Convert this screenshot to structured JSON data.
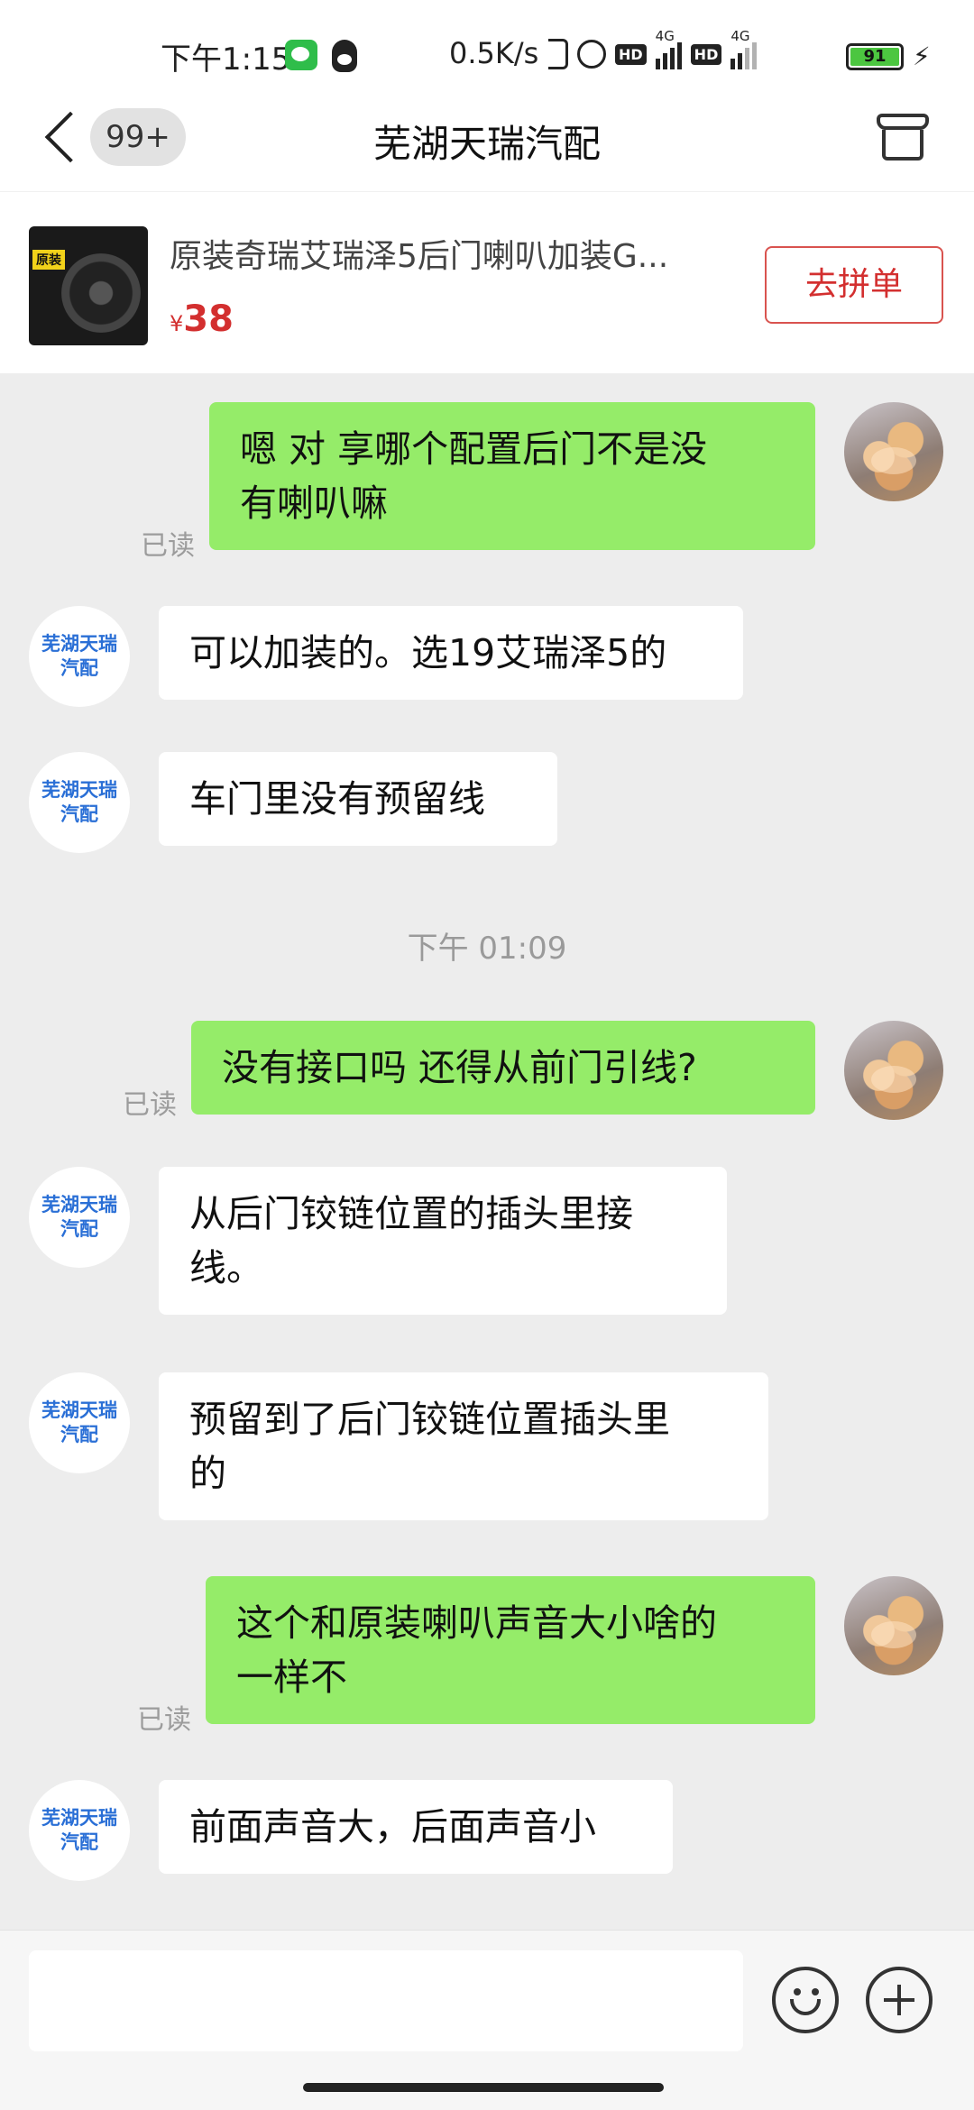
{
  "status_bar": {
    "time": "下午1:15",
    "net_speed": "0.5K/s",
    "hd1": "HD",
    "net1": "4G",
    "hd2": "HD",
    "net2": "4G",
    "battery_level": "91",
    "icons": [
      "wechat-icon",
      "qq-icon",
      "bluetooth-icon",
      "alarm-icon",
      "hd-icon",
      "signal-icon",
      "battery-icon",
      "charging-icon"
    ]
  },
  "header": {
    "back_icon": "back-arrow-icon",
    "unread_badge": "99+",
    "title": "芜湖天瑞汽配",
    "store_icon": "store-icon"
  },
  "product": {
    "image_tag": "原装",
    "title": "原装奇瑞艾瑞泽5后门喇叭加装G...",
    "currency": "¥",
    "price": "38",
    "action_label": "去拼单"
  },
  "shop_avatar": {
    "line1": "芜湖天瑞",
    "line2": "汽配"
  },
  "timestamp": "下午 01:09",
  "messages": [
    {
      "from": "me",
      "text": "嗯 对  享哪个配置后门不是没\n有喇叭嘛",
      "read": "已读"
    },
    {
      "from": "shop",
      "text": "可以加装的。选19艾瑞泽5的"
    },
    {
      "from": "shop",
      "text": "车门里没有预留线"
    },
    {
      "from": "me",
      "text": "没有接口吗  还得从前门引线?",
      "read": "已读"
    },
    {
      "from": "shop",
      "text": "从后门铰链位置的插头里接\n线。"
    },
    {
      "from": "shop",
      "text": "预留到了后门铰链位置插头里\n的"
    },
    {
      "from": "me",
      "text": "这个和原装喇叭声音大小啥的\n一样不",
      "read": "已读"
    },
    {
      "from": "shop",
      "text": "前面声音大，后面声音小"
    }
  ],
  "input_bar": {
    "placeholder": "",
    "emoji_icon": "emoji-icon",
    "plus_icon": "plus-icon"
  }
}
